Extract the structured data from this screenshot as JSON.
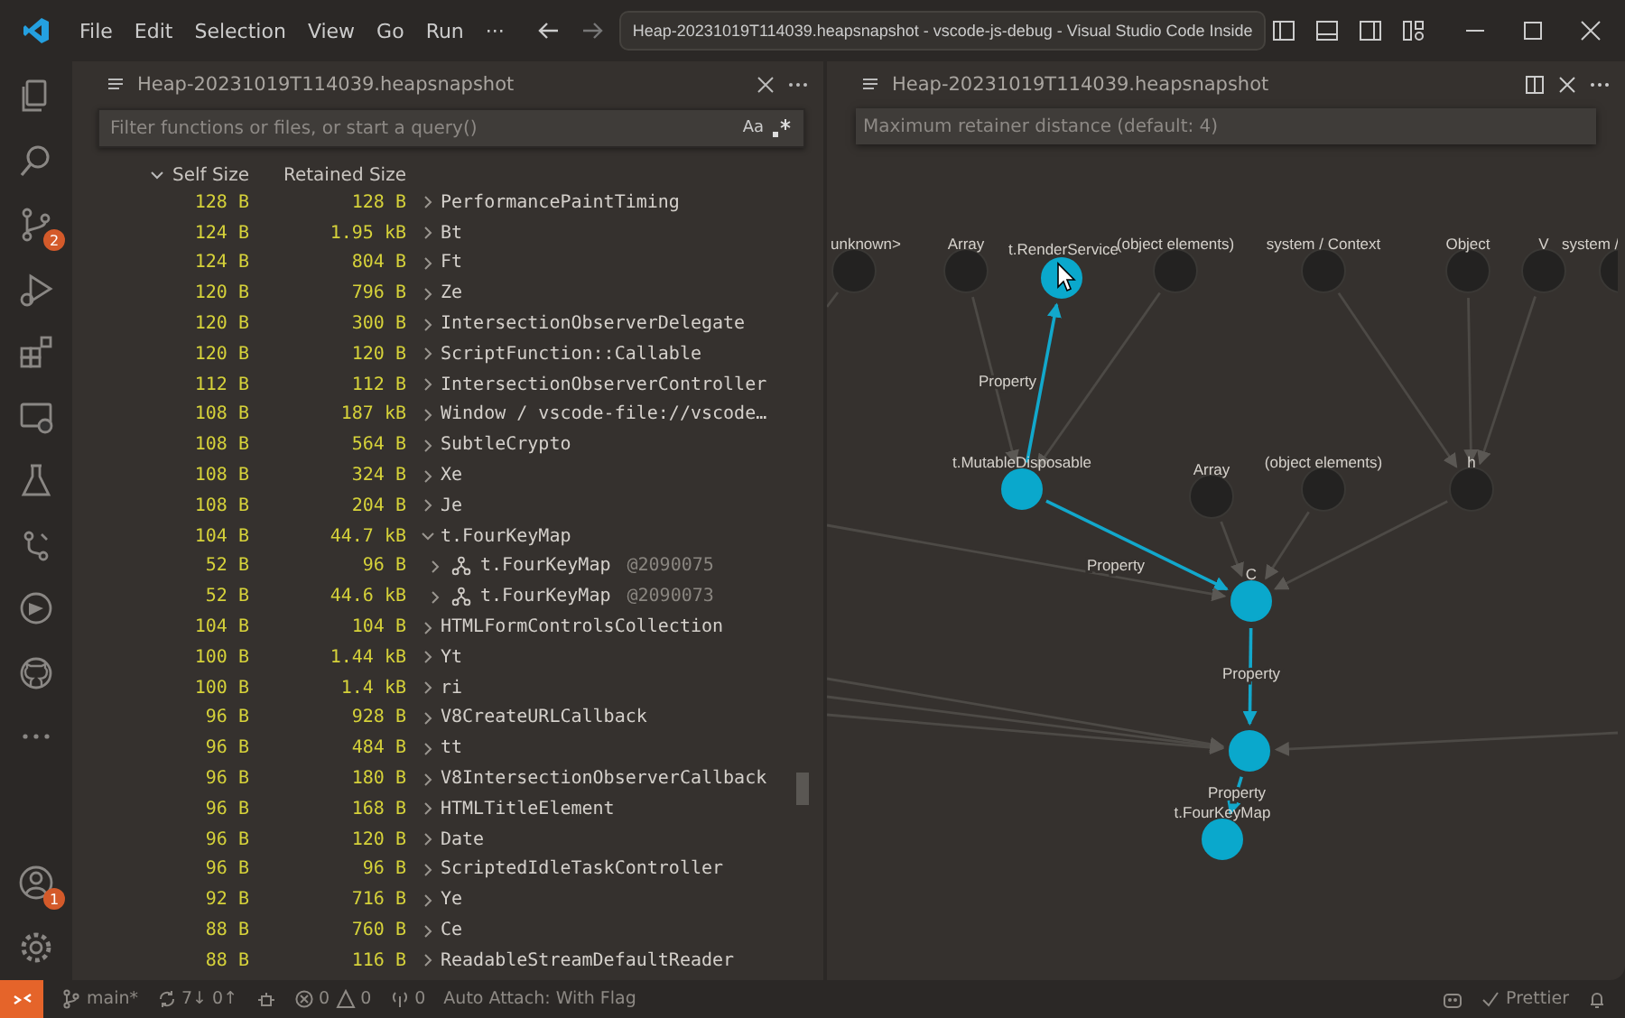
{
  "title_bar": {
    "menu": [
      "File",
      "Edit",
      "Selection",
      "View",
      "Go",
      "Run"
    ],
    "more": "···",
    "command_center": "Heap-20231019T114039.heapsnapshot - vscode-js-debug - Visual Studio Code Inside"
  },
  "activity_bar": {
    "items": [
      {
        "kind": "files"
      },
      {
        "kind": "search"
      },
      {
        "kind": "source-control",
        "badge": "2"
      },
      {
        "kind": "run"
      },
      {
        "kind": "extensions"
      },
      {
        "kind": "remote"
      },
      {
        "kind": "testing"
      },
      {
        "kind": "git"
      },
      {
        "kind": "timeline"
      },
      {
        "kind": "github"
      },
      {
        "kind": "more"
      }
    ],
    "bottom_items": [
      {
        "kind": "account",
        "badge": "1"
      },
      {
        "kind": "settings"
      }
    ]
  },
  "left_editor": {
    "tab_title": "Heap-20231019T114039.heapsnapshot",
    "filter_placeholder": "Filter functions or files, or start a query()",
    "case_toggle": "Aa",
    "columns": [
      {
        "label": "Self Size",
        "sorted": true
      },
      {
        "label": "Retained Size",
        "sorted": false
      }
    ],
    "rows": [
      {
        "self": "128 B",
        "retained": "128 B",
        "name": "PerformancePaintTiming",
        "expanded": false
      },
      {
        "self": "124 B",
        "retained": "1.95 kB",
        "name": "Bt",
        "expanded": false
      },
      {
        "self": "124 B",
        "retained": "804 B",
        "name": "Ft",
        "expanded": false
      },
      {
        "self": "120 B",
        "retained": "796 B",
        "name": "Ze",
        "expanded": false
      },
      {
        "self": "120 B",
        "retained": "300 B",
        "name": "IntersectionObserverDelegate",
        "expanded": false
      },
      {
        "self": "120 B",
        "retained": "120 B",
        "name": "ScriptFunction::Callable",
        "expanded": false
      },
      {
        "self": "112 B",
        "retained": "112 B",
        "name": "IntersectionObserverController",
        "expanded": false
      },
      {
        "self": "108 B",
        "retained": "187 kB",
        "name": "Window / vscode-file://vscode…",
        "expanded": false
      },
      {
        "self": "108 B",
        "retained": "564 B",
        "name": "SubtleCrypto",
        "expanded": false
      },
      {
        "self": "108 B",
        "retained": "324 B",
        "name": "Xe",
        "expanded": false
      },
      {
        "self": "108 B",
        "retained": "204 B",
        "name": "Je",
        "expanded": false
      },
      {
        "self": "104 B",
        "retained": "44.7 kB",
        "name": "t.FourKeyMap",
        "expanded": true,
        "children": [
          {
            "self": "52 B",
            "retained": "96 B",
            "name": "t.FourKeyMap",
            "id": "@2090075",
            "expanded": false
          },
          {
            "self": "52 B",
            "retained": "44.6 kB",
            "name": "t.FourKeyMap",
            "id": "@2090073",
            "expanded": false
          }
        ]
      },
      {
        "self": "104 B",
        "retained": "104 B",
        "name": "HTMLFormControlsCollection",
        "expanded": false
      },
      {
        "self": "100 B",
        "retained": "1.44 kB",
        "name": "Yt",
        "expanded": false
      },
      {
        "self": "100 B",
        "retained": "1.4 kB",
        "name": "ri",
        "expanded": false
      },
      {
        "self": "96 B",
        "retained": "928 B",
        "name": "V8CreateURLCallback",
        "expanded": false
      },
      {
        "self": "96 B",
        "retained": "484 B",
        "name": "tt",
        "expanded": false
      },
      {
        "self": "96 B",
        "retained": "180 B",
        "name": "V8IntersectionObserverCallback",
        "expanded": false
      },
      {
        "self": "96 B",
        "retained": "168 B",
        "name": "HTMLTitleElement",
        "expanded": false
      },
      {
        "self": "96 B",
        "retained": "120 B",
        "name": "Date",
        "expanded": false
      },
      {
        "self": "96 B",
        "retained": "96 B",
        "name": "ScriptedIdleTaskController",
        "expanded": false
      },
      {
        "self": "92 B",
        "retained": "716 B",
        "name": "Ye",
        "expanded": false
      },
      {
        "self": "88 B",
        "retained": "760 B",
        "name": "Ce",
        "expanded": false
      },
      {
        "self": "88 B",
        "retained": "116 B",
        "name": "ReadableStreamDefaultReader",
        "expanded": false
      }
    ]
  },
  "right_editor": {
    "tab_title": "Heap-20231019T114039.heapsnapshot",
    "distance_placeholder": "Maximum retainer distance (default: 4)",
    "graph": {
      "nodes": [
        {
          "label": "unknown>",
          "highlighted": false
        },
        {
          "label": "Array",
          "highlighted": false
        },
        {
          "label": "t.RenderService",
          "highlighted": true
        },
        {
          "label": "(object elements)",
          "highlighted": false
        },
        {
          "label": "system / Context",
          "highlighted": false
        },
        {
          "label": "Object",
          "highlighted": false
        },
        {
          "label": "V",
          "highlighted": false
        },
        {
          "label": "system /",
          "highlighted": false
        },
        {
          "label": "t.MutableDisposable",
          "highlighted": true
        },
        {
          "label": "Array",
          "highlighted": false
        },
        {
          "label": "(object elements)",
          "highlighted": false
        },
        {
          "label": "h",
          "highlighted": false
        },
        {
          "label": "C",
          "highlighted": true
        },
        {
          "highlighted": true
        },
        {
          "label": "t.FourKeyMap",
          "highlighted": true
        }
      ],
      "edges": [
        {
          "highlighted": false
        },
        {
          "highlighted": true,
          "label": "Property"
        },
        {
          "highlighted": false
        },
        {
          "highlighted": false
        },
        {
          "highlighted": false
        },
        {
          "highlighted": false
        },
        {
          "highlighted": true,
          "label": "Property"
        },
        {
          "highlighted": false
        },
        {
          "highlighted": false
        },
        {
          "highlighted": false
        },
        {
          "highlighted": true,
          "label": "Property"
        },
        {
          "highlighted": true,
          "label": "Property"
        },
        {
          "highlighted": false
        },
        {
          "highlighted": false
        },
        {
          "highlighted": false
        },
        {
          "highlighted": false
        },
        {
          "highlighted": false
        },
        {
          "highlighted": false
        }
      ]
    }
  },
  "status_bar": {
    "branch": "main*",
    "sync": "7↓ 0↑",
    "errors": "0",
    "warnings": "0",
    "ports": "0",
    "auto_attach": "Auto Attach: With Flag",
    "prettier": "Prettier"
  }
}
